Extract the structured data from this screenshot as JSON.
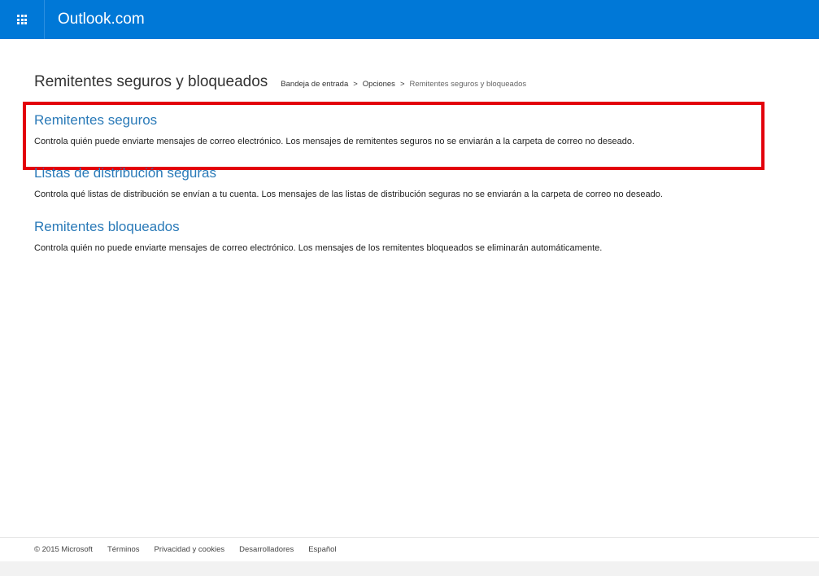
{
  "header": {
    "app_name": "Outlook.com",
    "launcher_icon": "waffle-grid-icon",
    "bar_color": "#0078d7"
  },
  "page": {
    "title": "Remitentes seguros y bloqueados",
    "breadcrumb": {
      "items": [
        "Bandeja de entrada",
        "Opciones"
      ],
      "separator": ">",
      "current": "Remitentes seguros y bloqueados"
    }
  },
  "sections": [
    {
      "title": "Remitentes seguros",
      "description": "Controla quién puede enviarte mensajes de correo electrónico. Los mensajes de remitentes seguros no se enviarán a la carpeta de correo no deseado.",
      "highlighted": true
    },
    {
      "title": "Listas de distribución seguras",
      "description": "Controla qué listas de distribución se envían a tu cuenta. Los mensajes de las listas de distribución seguras no se enviarán a la carpeta de correo no deseado."
    },
    {
      "title": "Remitentes bloqueados",
      "description": "Controla quién no puede enviarte mensajes de correo electrónico. Los mensajes de los remitentes bloqueados se eliminarán automáticamente."
    }
  ],
  "footer": {
    "copyright": "© 2015 Microsoft",
    "links": [
      "Términos",
      "Privacidad y cookies",
      "Desarrolladores",
      "Español"
    ]
  },
  "colors": {
    "accent": "#0078d7",
    "link": "#2a7ab8",
    "highlight": "#e3000b"
  }
}
